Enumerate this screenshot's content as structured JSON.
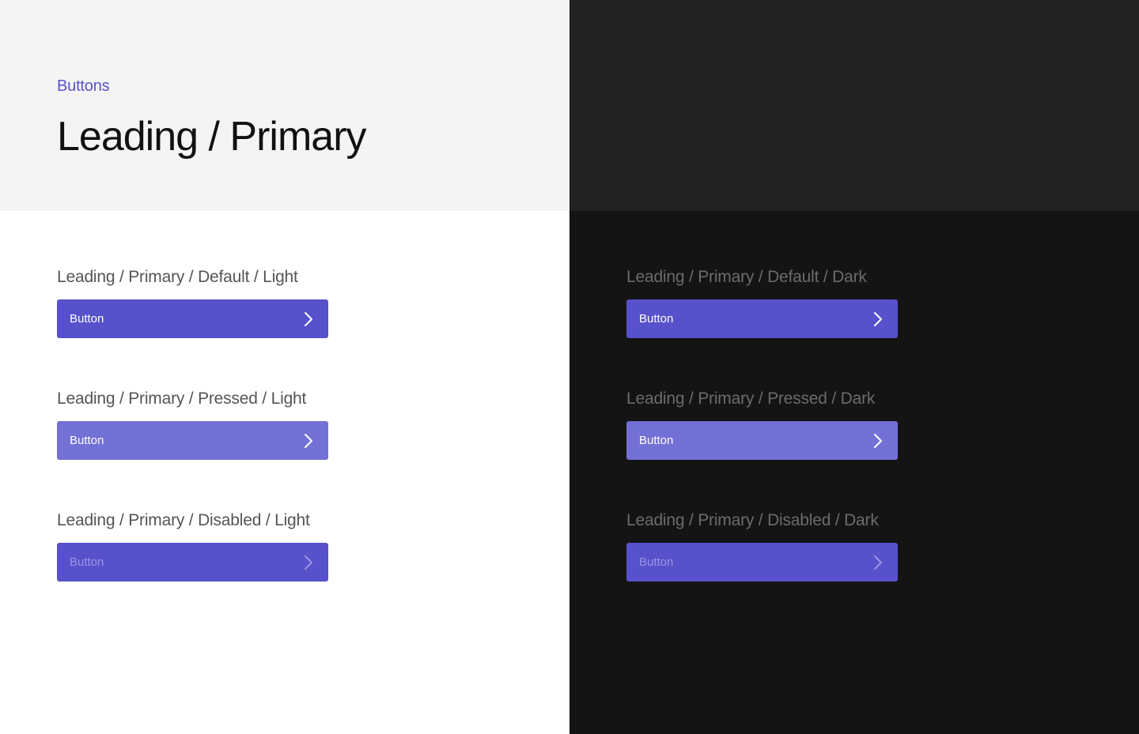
{
  "header": {
    "eyebrow": "Buttons",
    "title": "Leading / Primary"
  },
  "variants": {
    "light": [
      {
        "label": "Leading / Primary / Default / Light",
        "button_label": "Button",
        "state": "default"
      },
      {
        "label": "Leading / Primary / Pressed / Light",
        "button_label": "Button",
        "state": "pressed"
      },
      {
        "label": "Leading / Primary / Disabled / Light",
        "button_label": "Button",
        "state": "disabled"
      }
    ],
    "dark": [
      {
        "label": "Leading / Primary / Default / Dark",
        "button_label": "Button",
        "state": "default"
      },
      {
        "label": "Leading / Primary / Pressed / Dark",
        "button_label": "Button",
        "state": "pressed"
      },
      {
        "label": "Leading / Primary / Disabled / Dark",
        "button_label": "Button",
        "state": "disabled"
      }
    ]
  },
  "icons": {
    "button_trailing": "chevron-right-icon"
  },
  "colors": {
    "accent": "#5751cc",
    "accent_pressed": "#7370d6",
    "disabled_text": "#9a96e3",
    "light_header_bg": "#f4f4f4",
    "dark_header_bg": "#222222",
    "light_bg": "#ffffff",
    "dark_bg": "#141414"
  }
}
